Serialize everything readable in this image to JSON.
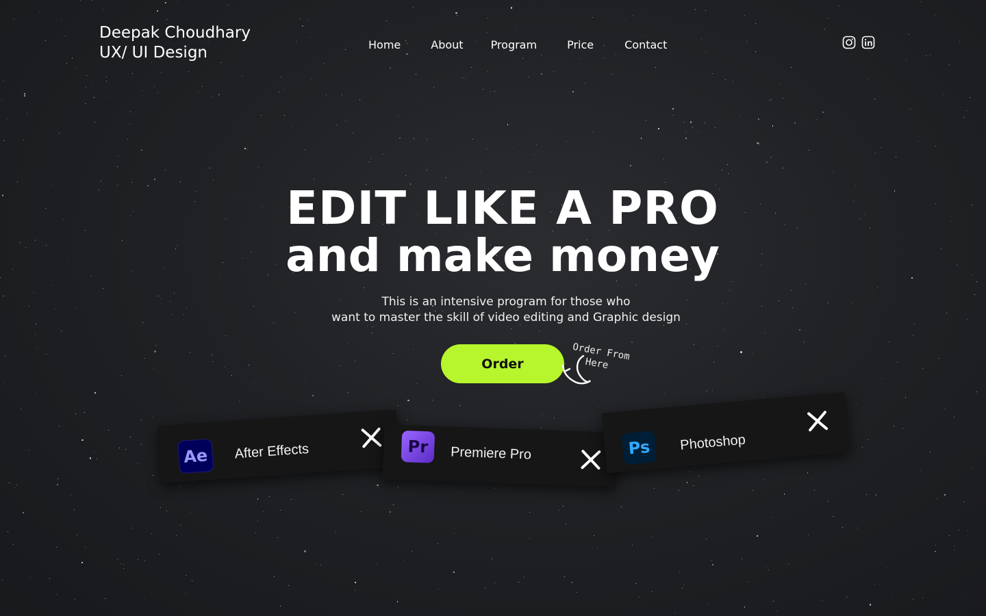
{
  "brand": {
    "name": "Deepak Choudhary",
    "tagline": "UX/ UI Design"
  },
  "nav": {
    "items": [
      "Home",
      "About",
      "Program",
      "Price",
      "Contact"
    ]
  },
  "social": {
    "icons": [
      "instagram-icon",
      "linkedin-icon"
    ]
  },
  "hero": {
    "title_line1": "EDIT LIKE A PRO",
    "title_line2": "and make money",
    "subtitle_line1": "This is an intensive program for those who",
    "subtitle_line2": "want to master the skill of video editing and Graphic design"
  },
  "cta": {
    "order_label": "Order",
    "hint_line1": "Order From",
    "hint_line2": "Here",
    "accent_color": "#b7f52c"
  },
  "tools": [
    {
      "abbr": "Ae",
      "name": "After Effects",
      "color": "#9999ff"
    },
    {
      "abbr": "Pr",
      "name": "Premiere Pro",
      "color": "#9a66ff"
    },
    {
      "abbr": "Ps",
      "name": "Photoshop",
      "color": "#31a8ff"
    }
  ]
}
